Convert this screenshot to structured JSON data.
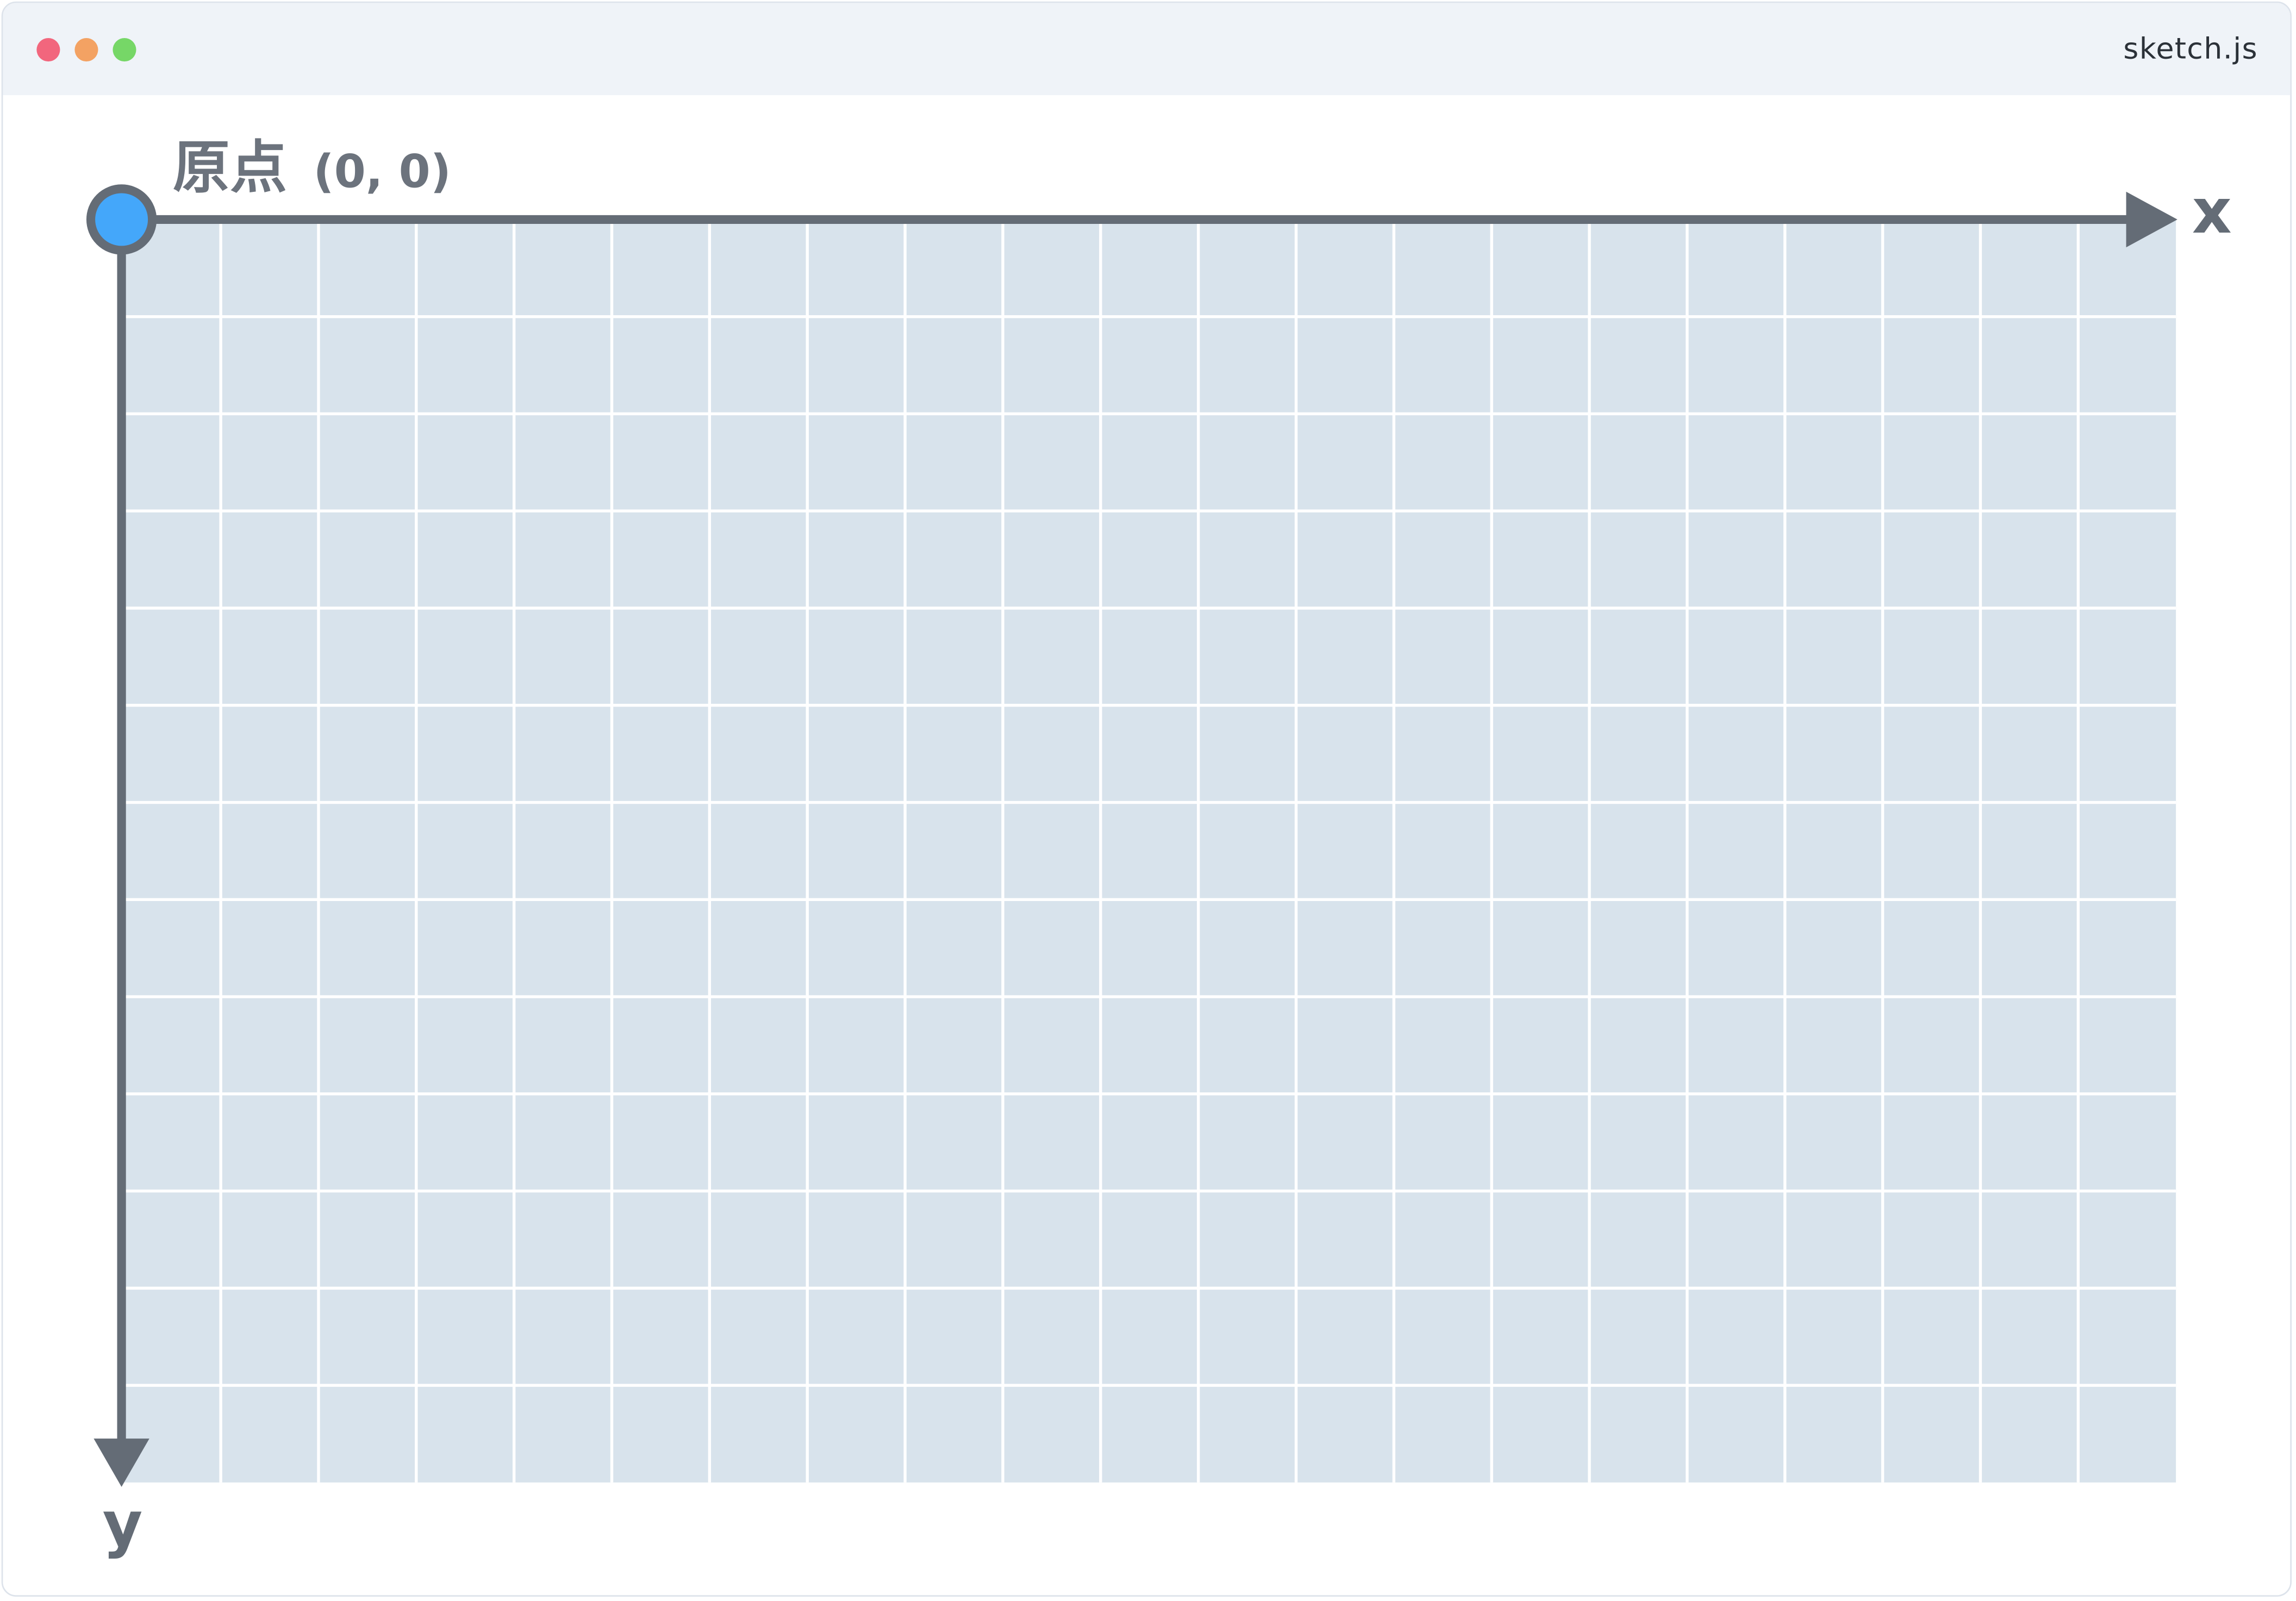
{
  "window": {
    "title": "sketch.js",
    "controls": [
      {
        "name": "close",
        "color": "#f2667d"
      },
      {
        "name": "minimize",
        "color": "#f3a263"
      },
      {
        "name": "maximize",
        "color": "#76d767"
      }
    ]
  },
  "diagram": {
    "origin_label": "原点",
    "origin_coord": "(0, 0)",
    "x_axis_label": "x",
    "y_axis_label": "y",
    "grid_columns": 21,
    "grid_rows": 13,
    "colors": {
      "grid_fill": "#d8e3ec",
      "grid_line": "#ffffff",
      "axis": "#646c76",
      "origin_point": "#44a7fa"
    }
  }
}
